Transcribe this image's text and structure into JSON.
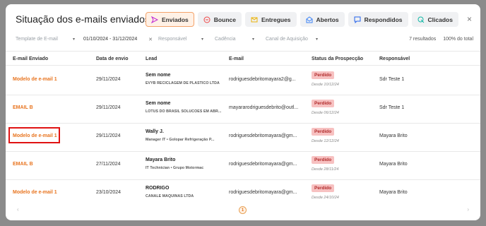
{
  "modal": {
    "title": "Situação dos e-mails enviados",
    "close_icon": "×",
    "tabs": [
      {
        "label": "Enviados",
        "icon": "send-icon",
        "active": true
      },
      {
        "label": "Bounce",
        "icon": "bounce-icon",
        "active": false
      },
      {
        "label": "Entregues",
        "icon": "envelope-icon",
        "active": false
      },
      {
        "label": "Abertos",
        "icon": "open-envelope-icon",
        "active": false
      },
      {
        "label": "Respondidos",
        "icon": "reply-icon",
        "active": false
      },
      {
        "label": "Clicados",
        "icon": "click-icon",
        "active": false
      }
    ]
  },
  "filters": {
    "template_placeholder": "Template de E-mail",
    "date_range": "01/10/2024 - 31/12/2024",
    "responsavel_placeholder": "Responsável",
    "cadencia_placeholder": "Cadência",
    "canal_placeholder": "Canal de Aquisição",
    "results": "7 resultados",
    "zoom": "100% do total"
  },
  "table": {
    "headers": [
      "E-mail Enviado",
      "Data de envio",
      "Lead",
      "E-mail",
      "Status da Prospecção",
      "Responsável"
    ],
    "rows": [
      {
        "template": "Modelo de e-mail 1",
        "date": "29/11/2024",
        "lead": "Sem nome",
        "company": "EVYB RECICLAGEM DE PLASTICO LTDA",
        "email": "rodriguesdebritomayara2@g...",
        "status": "Perdido",
        "since": "Desde 10/12/24",
        "owner": "Sdr Teste 1"
      },
      {
        "template": "EMAIL B",
        "date": "29/11/2024",
        "lead": "Sem nome",
        "company": "LOTUS DO BRASIL SOLUCOES EM ABR...",
        "email": "mayararodriguesdebrito@outl...",
        "status": "Perdido",
        "since": "Desde 06/12/24",
        "owner": "Sdr Teste 1"
      },
      {
        "template": "Modelo de e-mail 1",
        "date": "29/11/2024",
        "lead": "Wally J.",
        "company": "Manager IT • Golopar Refrigeração P...",
        "email": "rodriguesdebritomayara@gm...",
        "status": "Perdido",
        "since": "Desde 12/12/24",
        "owner": "Mayara Brito"
      },
      {
        "template": "EMAIL B",
        "date": "27/11/2024",
        "lead": "Mayara Brito",
        "company": "IT Technician • Grupo Motormac",
        "email": "rodriguesdebritomayara@gm...",
        "status": "Perdido",
        "since": "Desde 28/11/24",
        "owner": "Mayara Brito"
      },
      {
        "template": "Modelo de e-mail 1",
        "date": "23/10/2024",
        "lead": "RODRIGO",
        "company": "CANALE MAQUINAS LTDA",
        "email": "rodriguesdebritomayara@gm...",
        "status": "Perdido",
        "since": "Desde 24/10/24",
        "owner": "Mayara Brito"
      }
    ]
  },
  "pager": {
    "prev": "‹",
    "current": "1",
    "next": "›"
  }
}
